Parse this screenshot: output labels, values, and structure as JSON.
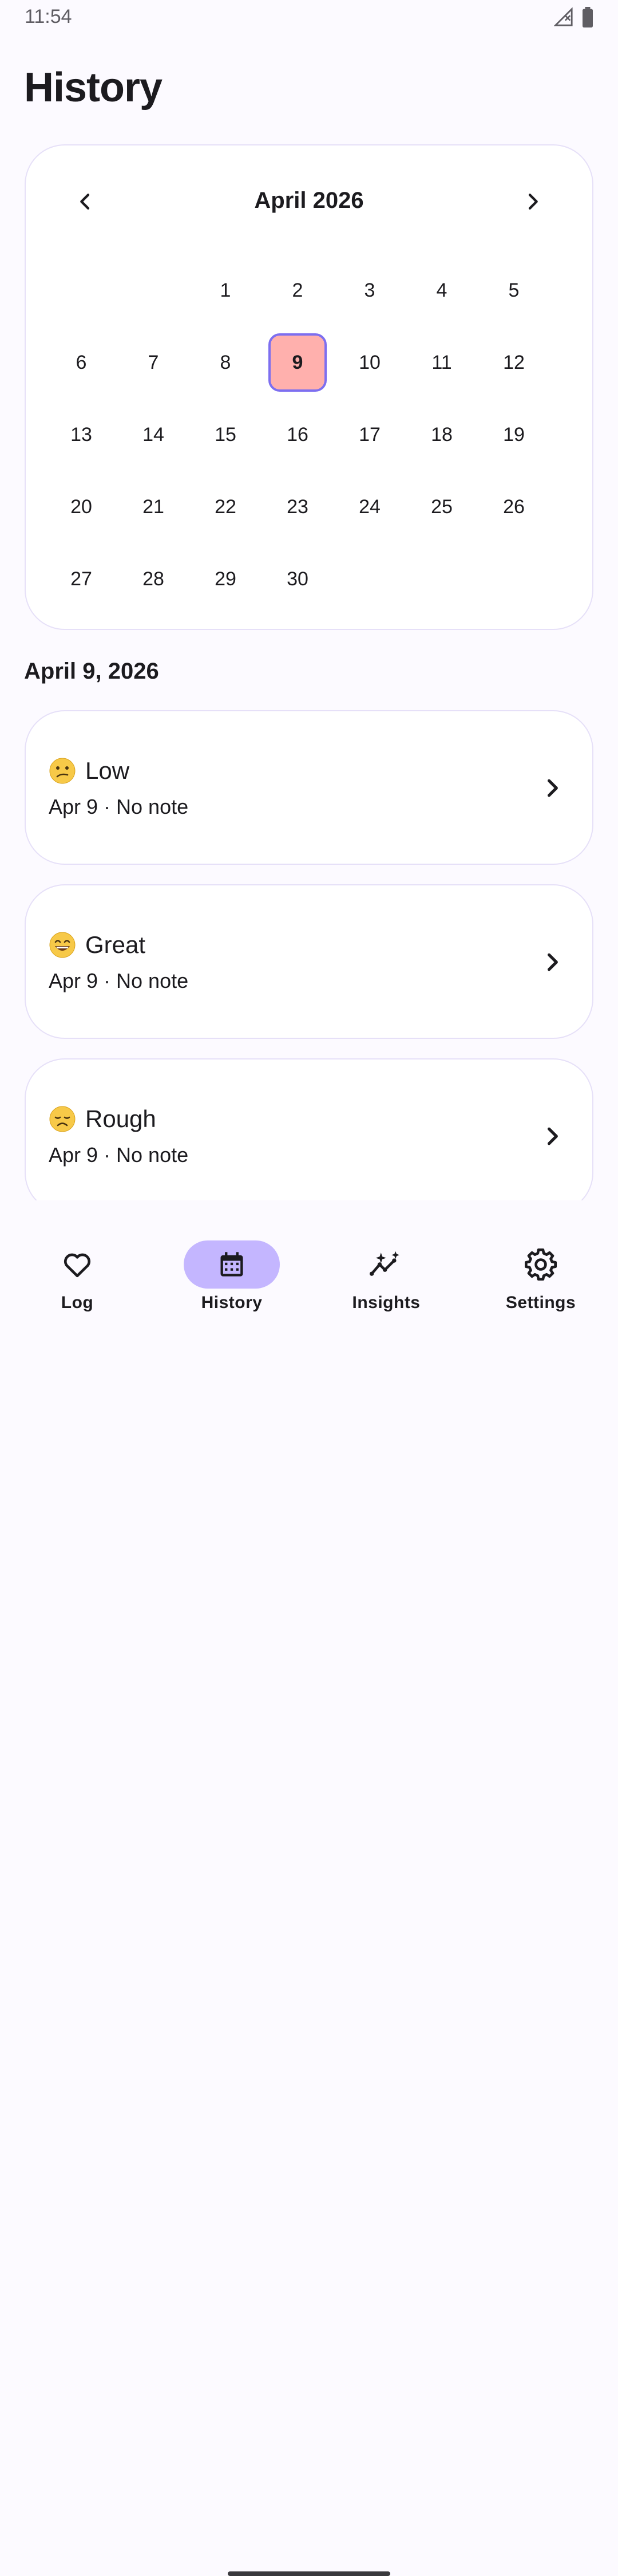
{
  "status": {
    "time": "11:54"
  },
  "page": {
    "title": "History"
  },
  "calendar": {
    "month_label": "April 2026",
    "leading_blanks": 2,
    "days": [
      "1",
      "2",
      "3",
      "4",
      "5",
      "6",
      "7",
      "8",
      "9",
      "10",
      "11",
      "12",
      "13",
      "14",
      "15",
      "16",
      "17",
      "18",
      "19",
      "20",
      "21",
      "22",
      "23",
      "24",
      "25",
      "26",
      "27",
      "28",
      "29",
      "30"
    ],
    "selected_day": "9",
    "selected_color": "#ffb0ad",
    "selected_border": "#7d6ff0"
  },
  "selected_date_heading": "April 9, 2026",
  "entries": [
    {
      "mood": "Low",
      "icon": "confused-face-icon",
      "subtitle": "Apr 9 · No note"
    },
    {
      "mood": "Great",
      "icon": "grinning-face-icon",
      "subtitle": "Apr 9 · No note"
    },
    {
      "mood": "Rough",
      "icon": "disappointed-face-icon",
      "subtitle": "Apr 9 · No note"
    }
  ],
  "nav": {
    "items": [
      {
        "label": "Log",
        "icon": "heart-icon"
      },
      {
        "label": "History",
        "icon": "calendar-icon",
        "active": true
      },
      {
        "label": "Insights",
        "icon": "sparkle-chart-icon"
      },
      {
        "label": "Settings",
        "icon": "gear-icon"
      }
    ],
    "active_color": "#c4b6ff"
  }
}
